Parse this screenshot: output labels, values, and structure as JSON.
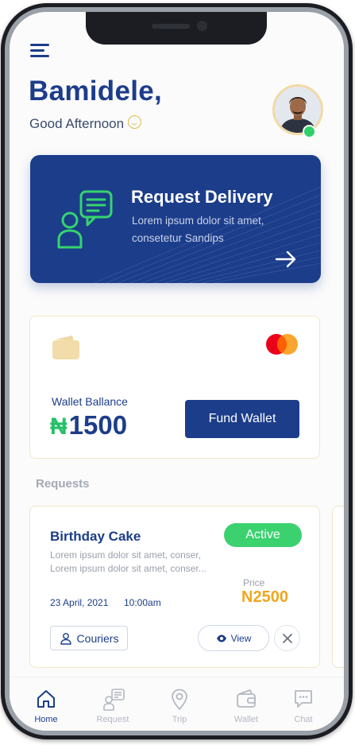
{
  "user": {
    "name": "Bamidele,",
    "greeting": "Good Afternoon"
  },
  "delivery_card": {
    "title": "Request Delivery",
    "description": "Lorem ipsum dolor sit amet, consetetur Sandips"
  },
  "wallet": {
    "label": "Wallet Ballance",
    "currency_symbol": "₦",
    "amount": "1500",
    "fund_button": "Fund Wallet"
  },
  "requests": {
    "section_title": "Requests",
    "items": [
      {
        "title": "Birthday Cake",
        "description": "Lorem ipsum dolor sit amet, conser, Lorem ipsum dolor sit amet, conser...",
        "status": "Active",
        "price_label": "Price",
        "price": "N2500",
        "date": "23 April, 2021",
        "time": "10:00am",
        "couriers_label": "Couriers",
        "view_label": "View"
      }
    ]
  },
  "nav": [
    {
      "label": "Home",
      "icon": "home-icon",
      "active": true
    },
    {
      "label": "Request",
      "icon": "request-icon",
      "active": false
    },
    {
      "label": "Trip",
      "icon": "location-pin-icon",
      "active": false
    },
    {
      "label": "Wallet",
      "icon": "wallet-icon",
      "active": false
    },
    {
      "label": "Chat",
      "icon": "chat-icon",
      "active": false
    }
  ],
  "colors": {
    "primary": "#1c3d8a",
    "success": "#3bd16f",
    "accent": "#f0a61e",
    "background": "#fbfbfc"
  }
}
